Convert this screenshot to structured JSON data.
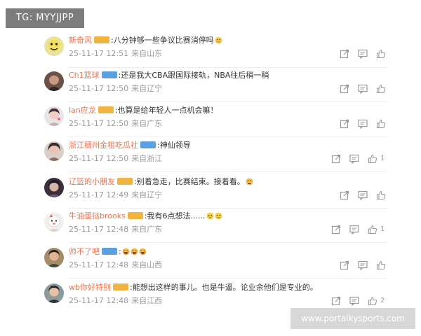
{
  "overlay": {
    "tg_label": "TG: MYYJJPP",
    "watermark": "www.portalkysports.com"
  },
  "comments": [
    {
      "user": "新奇风",
      "badge": "",
      "badge_color": "orange",
      "text": ":八分钟够一些争议比赛消停吗",
      "emojis": [
        "shy-face-icon"
      ],
      "date": "25-11-17 12:51",
      "location": "来自山东",
      "likes": ""
    },
    {
      "user": "Ch1篮球",
      "badge": "",
      "badge_color": "blue",
      "text": ":还是我大CBA跟国际接轨，NBA往后稍一稍",
      "emojis": [],
      "date": "25-11-17 12:50",
      "location": "来自辽宁",
      "likes": ""
    },
    {
      "user": "lan应龙",
      "badge": "",
      "badge_color": "orange",
      "text": ":也算是给年轻人一点机会嘛！",
      "emojis": [],
      "date": "25-11-17 12:50",
      "location": "来自广东",
      "likes": ""
    },
    {
      "user": "浙江稠州金租吃瓜社",
      "badge": "",
      "badge_color": "blue",
      "text": ":神仙领导",
      "emojis": [],
      "date": "25-11-17 12:50",
      "location": "来自浙江",
      "likes": "1"
    },
    {
      "user": "辽篮的小朋友",
      "badge": "",
      "badge_color": "orange",
      "text": ":别着急走，比赛结束。接着看。",
      "emojis": [
        "grin-face-icon"
      ],
      "date": "25-11-17 12:49",
      "location": "来自辽宁",
      "likes": ""
    },
    {
      "user": "牛油蛋挞brooks",
      "badge": "",
      "badge_color": "orange",
      "text": ":我有6点想法......",
      "emojis": [
        "shy-face-icon",
        "shy-face-icon"
      ],
      "date": "25-11-17 12:48",
      "location": "来自广东",
      "likes": "1"
    },
    {
      "user": "帅不了吧",
      "badge": "",
      "badge_color": "blue",
      "text": ":",
      "emojis": [
        "laugh-face-icon",
        "laugh-face-icon",
        "laugh-face-icon"
      ],
      "date": "25-11-17 12:48",
      "location": "来自山西",
      "likes": ""
    },
    {
      "user": "wb你好特别",
      "badge": "",
      "badge_color": "orange",
      "text": ":能想出这样的事儿。也是牛逼。论业余他们是专业的。",
      "emojis": [],
      "date": "25-11-17 12:48",
      "location": "来自江西",
      "likes": "2"
    }
  ],
  "colors": {
    "username": "#eb7350",
    "meta": "#9a9a9a",
    "text": "#333333"
  }
}
